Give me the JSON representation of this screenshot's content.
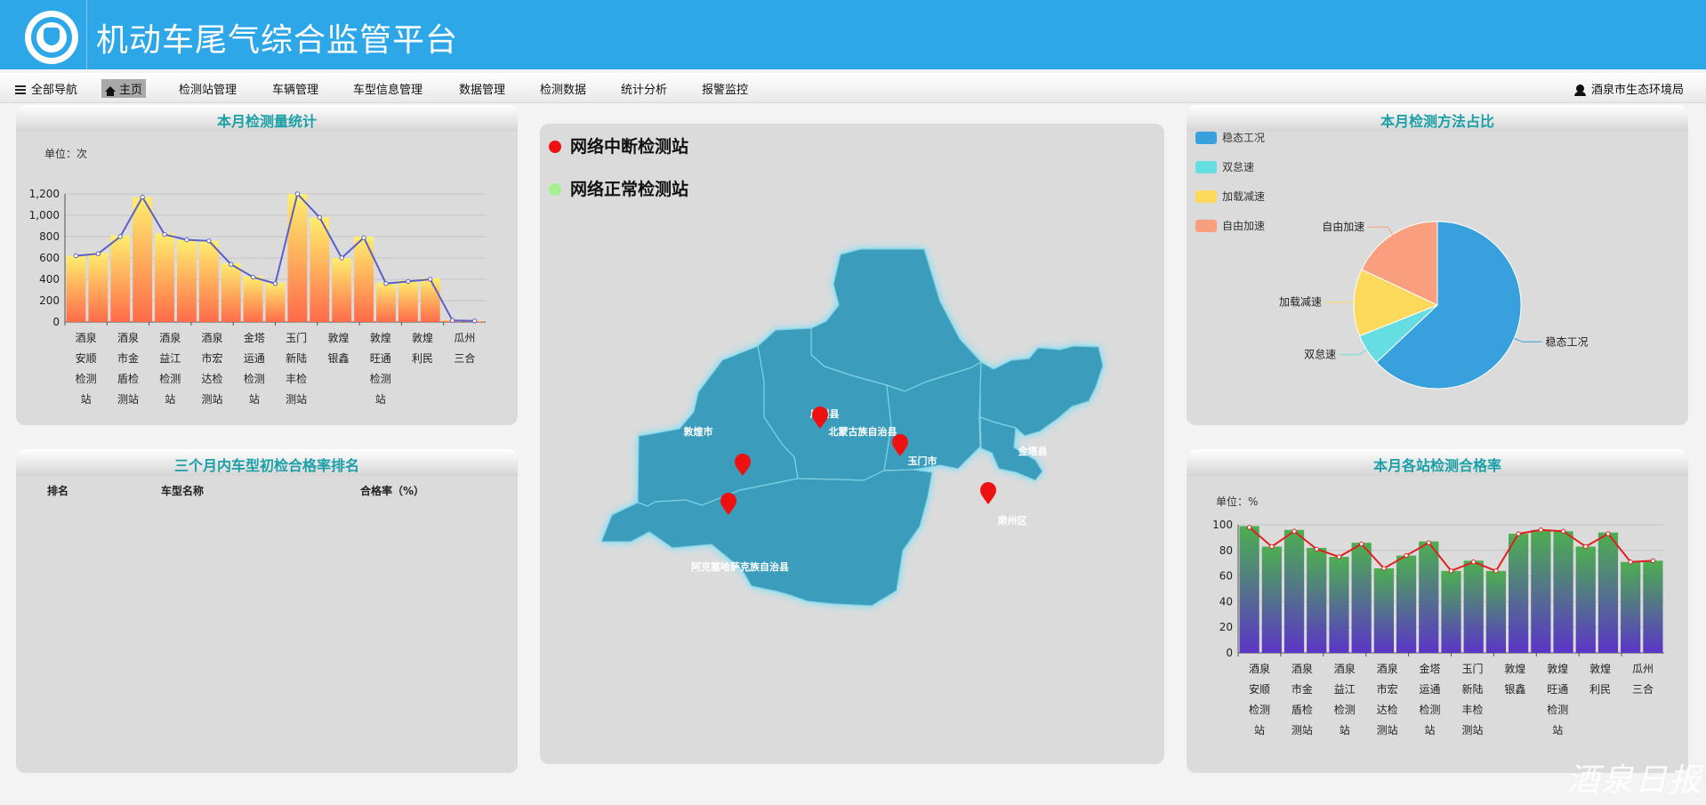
{
  "header": {
    "title": "机动车尾气综合监管平台",
    "logo": "environmental-protection-emblem"
  },
  "nav": {
    "all_nav": "全部导航",
    "home": "主页",
    "items": [
      "检测站管理",
      "车辆管理",
      "车型信息管理",
      "数据管理",
      "检测数据",
      "统计分析",
      "报警监控"
    ],
    "user": "酒泉市生态环境局"
  },
  "panels": {
    "monthly_volume": {
      "title": "本月检测量统计",
      "unit": "单位：次"
    },
    "model_rank": {
      "title": "三个月内车型初检合格率排名",
      "columns": [
        "排名",
        "车型名称",
        "合格率（%）"
      ]
    },
    "method_share": {
      "title": "本月检测方法占比"
    },
    "pass_rate": {
      "title": "本月各站检测合格率",
      "unit": "单位：%"
    }
  },
  "map": {
    "legend_interrupted": "网络中断检测站",
    "legend_normal": "网络正常检测站",
    "colors": {
      "region": "#3a9dbb",
      "interrupted": "#ee1111",
      "normal": "#a6f08f"
    },
    "regions": [
      "敦煌市",
      "瓜州县",
      "北蒙古族自治县",
      "玉门市",
      "金塔县",
      "肃州区",
      "阿克塞哈萨克族自治县"
    ]
  },
  "watermark": "酒泉日报",
  "chart_data": [
    {
      "type": "bar",
      "title": "本月检测量统计",
      "ylabel": "单位：次",
      "ylim": [
        0,
        1200
      ],
      "yticks": [
        "0",
        "200",
        "400",
        "600",
        "800",
        "1,000",
        "1,200"
      ],
      "category_labels": [
        [
          "酒泉",
          "安顺",
          "检测",
          "站"
        ],
        [
          "酒泉",
          "市金",
          "盾检",
          "测站"
        ],
        [
          "酒泉",
          "益江",
          "检测",
          "站"
        ],
        [
          "酒泉",
          "市宏",
          "达检",
          "测站"
        ],
        [
          "金塔",
          "运通",
          "检测",
          "站"
        ],
        [
          "玉门",
          "新陆",
          "丰检",
          "测站"
        ],
        [
          "敦煌",
          "银鑫"
        ],
        [
          "敦煌",
          "旺通",
          "检测",
          "站"
        ],
        [
          "敦煌",
          "利民"
        ],
        [
          "瓜州",
          "三合"
        ]
      ],
      "bar_values": [
        620,
        650,
        810,
        1170,
        830,
        770,
        760,
        550,
        430,
        370,
        1200,
        980,
        600,
        800,
        370,
        390,
        410,
        20,
        10
      ],
      "line_values": [
        620,
        640,
        800,
        1170,
        820,
        770,
        760,
        540,
        420,
        360,
        1200,
        980,
        600,
        790,
        360,
        380,
        400,
        15,
        10
      ],
      "colors": {
        "bar_top": "#ffee6e",
        "bar_bottom": "#ff6b4a",
        "line": "#5a5fc8"
      },
      "grid": true
    },
    {
      "type": "pie",
      "title": "本月检测方法占比",
      "legend": "top-left",
      "slices": [
        {
          "name": "稳态工况",
          "value": 63,
          "color": "#38a0dc"
        },
        {
          "name": "双怠速",
          "value": 6,
          "color": "#66dde0"
        },
        {
          "name": "加载减速",
          "value": 13,
          "color": "#fcd85b"
        },
        {
          "name": "自由加速",
          "value": 18,
          "color": "#fa9f7e"
        }
      ]
    },
    {
      "type": "bar",
      "title": "本月各站检测合格率",
      "ylabel": "单位：%",
      "ylim": [
        0,
        100
      ],
      "yticks": [
        "0",
        "20",
        "40",
        "60",
        "80",
        "100"
      ],
      "category_labels": [
        [
          "酒泉",
          "安顺",
          "检测",
          "站"
        ],
        [
          "酒泉",
          "市金",
          "盾检",
          "测站"
        ],
        [
          "酒泉",
          "益江",
          "检测",
          "站"
        ],
        [
          "酒泉",
          "市宏",
          "达检",
          "测站"
        ],
        [
          "金塔",
          "运通",
          "检测",
          "站"
        ],
        [
          "玉门",
          "新陆",
          "丰检",
          "测站"
        ],
        [
          "敦煌",
          "银鑫"
        ],
        [
          "敦煌",
          "旺通",
          "检测",
          "站"
        ],
        [
          "敦煌",
          "利民"
        ],
        [
          "瓜州",
          "三合"
        ]
      ],
      "bar_values": [
        99,
        83,
        96,
        82,
        75,
        86,
        66,
        76,
        87,
        64,
        72,
        64,
        93,
        96,
        95,
        83,
        94,
        71,
        72
      ],
      "line_values": [
        98,
        83,
        95,
        81,
        75,
        85,
        66,
        76,
        86,
        64,
        71,
        64,
        93,
        96,
        95,
        83,
        93,
        71,
        72
      ],
      "colors": {
        "bar_top": "#4caf50",
        "bar_bottom": "#5b35c7",
        "line": "#e02020"
      },
      "grid": true
    }
  ]
}
